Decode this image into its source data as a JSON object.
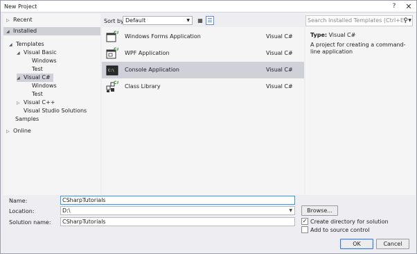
{
  "window": {
    "title": "New Project",
    "help_label": "?",
    "close_label": "✕"
  },
  "tree": {
    "recent": "Recent",
    "installed": "Installed",
    "templates": "Templates",
    "visual_basic": "Visual Basic",
    "vb_windows": "Windows",
    "vb_test": "Test",
    "visual_csharp": "Visual C#",
    "cs_windows": "Windows",
    "cs_test": "Test",
    "visual_cpp": "Visual C++",
    "vs_solutions": "Visual Studio Solutions",
    "samples": "Samples",
    "online": "Online"
  },
  "sort": {
    "label": "Sort by:",
    "value": "Default"
  },
  "templates": [
    {
      "name": "Windows Forms Application",
      "lang": "Visual C#",
      "icon": "windows-forms-icon"
    },
    {
      "name": "WPF Application",
      "lang": "Visual C#",
      "icon": "wpf-icon"
    },
    {
      "name": "Console Application",
      "lang": "Visual C#",
      "icon": "console-icon"
    },
    {
      "name": "Class Library",
      "lang": "Visual C#",
      "icon": "class-library-icon"
    }
  ],
  "details": {
    "search_placeholder": "Search Installed Templates (Ctrl+E)",
    "type_label": "Type:",
    "type_value": "Visual C#",
    "description": "A project for creating a command-line application"
  },
  "form": {
    "name_label": "Name:",
    "name_value": "CSharpTutorials",
    "location_label": "Location:",
    "location_value": "D:\\",
    "solution_label": "Solution name:",
    "solution_value": "CSharpTutorials",
    "browse_label": "Browse...",
    "create_dir_label": "Create directory for solution",
    "create_dir_checked": true,
    "source_control_label": "Add to source control",
    "source_control_checked": false,
    "ok_label": "OK",
    "cancel_label": "Cancel"
  },
  "colors": {
    "accent": "#3399ff",
    "selected_row": "#cfd0d8",
    "panel": "#f5f5f5",
    "chrome": "#eeeef2"
  }
}
